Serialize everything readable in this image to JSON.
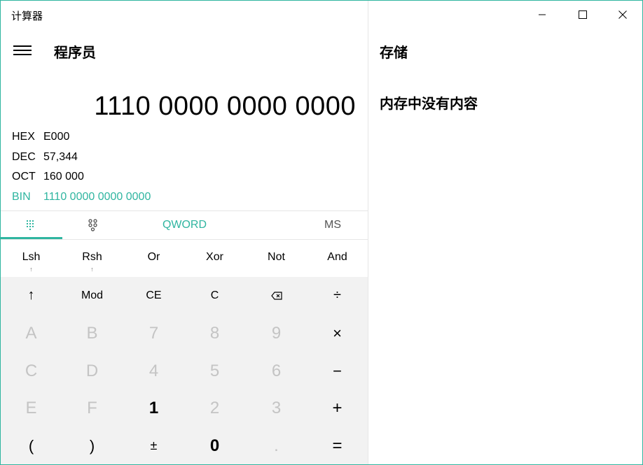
{
  "window": {
    "title": "计算器",
    "accent": "#2fb5a0"
  },
  "header": {
    "mode_title": "程序员",
    "menu_icon": "hamburger-icon"
  },
  "display": {
    "value": "1110 0000 0000 0000"
  },
  "radix": [
    {
      "label": "HEX",
      "value": "E000",
      "active": false
    },
    {
      "label": "DEC",
      "value": "57,344",
      "active": false
    },
    {
      "label": "OCT",
      "value": "160 000",
      "active": false
    },
    {
      "label": "BIN",
      "value": "1110 0000 0000 0000",
      "active": true
    }
  ],
  "tabs": {
    "keypad_icon": "full-keypad-icon",
    "bit_toggle_icon": "bit-toggle-keypad-icon",
    "word_size": "QWORD",
    "memory_store": "MS"
  },
  "bit_ops": [
    {
      "label": "Lsh",
      "sub": "↑"
    },
    {
      "label": "Rsh",
      "sub": "↑"
    },
    {
      "label": "Or",
      "sub": ""
    },
    {
      "label": "Xor",
      "sub": ""
    },
    {
      "label": "Not",
      "sub": ""
    },
    {
      "label": "And",
      "sub": ""
    }
  ],
  "keys": {
    "r1": [
      "↑",
      "Mod",
      "CE",
      "C",
      "backspace",
      "÷"
    ],
    "r2": [
      "A",
      "B",
      "7",
      "8",
      "9",
      "×"
    ],
    "r3": [
      "C",
      "D",
      "4",
      "5",
      "6",
      "−"
    ],
    "r4": [
      "E",
      "F",
      "1",
      "2",
      "3",
      "+"
    ],
    "r5": [
      "(",
      ")",
      "±",
      "0",
      ".",
      "="
    ]
  },
  "memory": {
    "title": "存储",
    "empty_text": "内存中没有内容"
  }
}
